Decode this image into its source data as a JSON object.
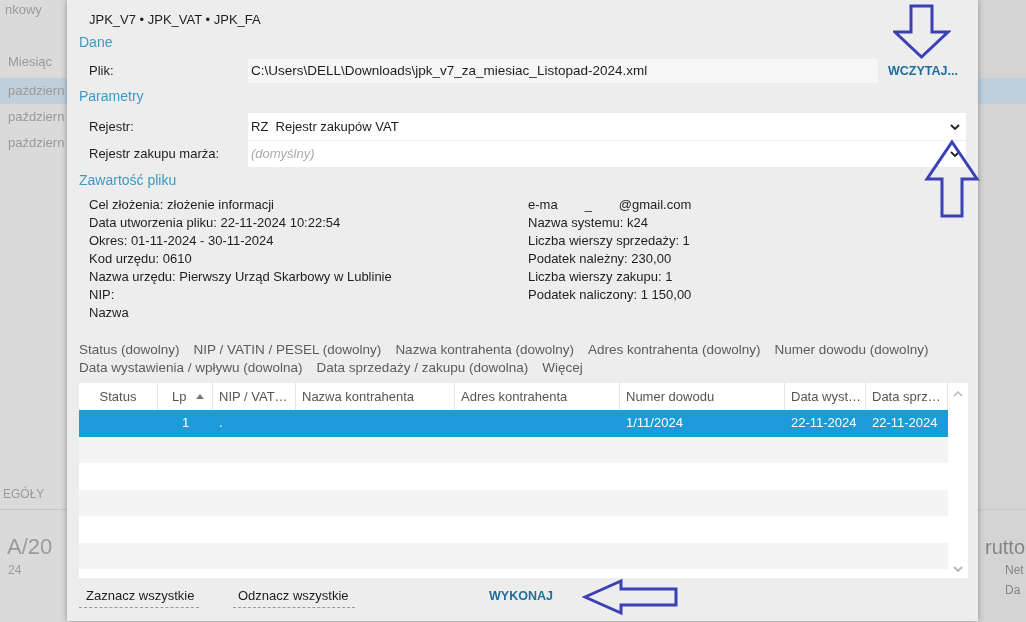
{
  "background": {
    "left": {
      "menu_label": "nkowy",
      "column_header": "Miesiąc",
      "rows": [
        {
          "text": "październ",
          "selected": true
        },
        {
          "text": "październ",
          "selected": false
        },
        {
          "text": "październ",
          "selected": false
        }
      ],
      "tab_label": "EGÓŁY",
      "document_number": "A/20",
      "date_fragment": "24"
    },
    "right": {
      "amount_label": "rutto",
      "net_label": "Net",
      "date_label": "Da"
    }
  },
  "dialog": {
    "formats": "JPK_V7 • JPK_VAT • JPK_FA",
    "data_section": {
      "title": "Dane",
      "file_label": "Plik:",
      "file_path": "C:\\Users\\DELL\\Downloads\\jpk_v7_za_miesiac_Listopad-2024.xml",
      "load_button": "WCZYTAJ..."
    },
    "parameters_section": {
      "title": "Parametry",
      "fields": [
        {
          "label": "Rejestr:",
          "value": "RZ  Rejestr zakupów VAT"
        },
        {
          "label": "Rejestr zakupu marża:",
          "placeholder": "(domyślny)"
        }
      ]
    },
    "contents_section": {
      "title": "Zawartość pliku",
      "left_lines": [
        [
          "Cel złożenia: złożenie informacji"
        ],
        [
          "Data utworzenia pliku: 22-11-2024 10:22:54"
        ],
        [
          "Okres: 01-11-2024 - 30-11-2024"
        ],
        [
          "Kod urzędu: 0610"
        ],
        [
          "Nazwa urzędu: Pierwszy Urząd Skarbowy w Lublinie"
        ],
        [
          "NIP:"
        ],
        [
          "Nazwa"
        ]
      ],
      "right_lines": [
        [
          "e-ma",
          "_",
          "@gmail.com"
        ],
        [
          "Nazwa systemu: k24"
        ],
        [
          "Liczba wierszy sprzedaży: 1"
        ],
        [
          "Podatek należny: 230,00"
        ],
        [
          "Liczba wierszy zakupu: 1"
        ],
        [
          "Podatek naliczony: 1 150,00"
        ]
      ]
    },
    "filters": [
      "Status (dowolny)",
      "NIP / VATIN / PESEL (dowolny)",
      "Nazwa kontrahenta (dowolny)",
      "Adres kontrahenta (dowolny)",
      "Numer dowodu (dowolny)",
      "Data wystawienia / wpływu (dowolna)",
      "Data sprzedaży / zakupu (dowolna)",
      "Więcej"
    ],
    "table": {
      "columns": [
        {
          "label": "Status",
          "sorted_ascending": false
        },
        {
          "label": "Lp",
          "sorted_ascending": true
        },
        {
          "label": "NIP / VAT…",
          "sorted_ascending": false
        },
        {
          "label": "Nazwa kontrahenta",
          "sorted_ascending": false
        },
        {
          "label": "Adres kontrahenta",
          "sorted_ascending": false
        },
        {
          "label": "Numer dowodu",
          "sorted_ascending": false
        },
        {
          "label": "Data wyst…",
          "sorted_ascending": false
        },
        {
          "label": "Data sprz…",
          "sorted_ascending": false
        }
      ],
      "rows": [
        {
          "selected": true,
          "lp": "1",
          "nip": ".",
          "document_number": "1/11/2024",
          "issue_date": "22-11-2024",
          "sale_date": "22-11-2024"
        }
      ]
    },
    "select_all_button": "Zaznacz wszystkie",
    "deselect_all_button": "Odznacz wszystkie",
    "execute_button": "WYKONAJ"
  }
}
